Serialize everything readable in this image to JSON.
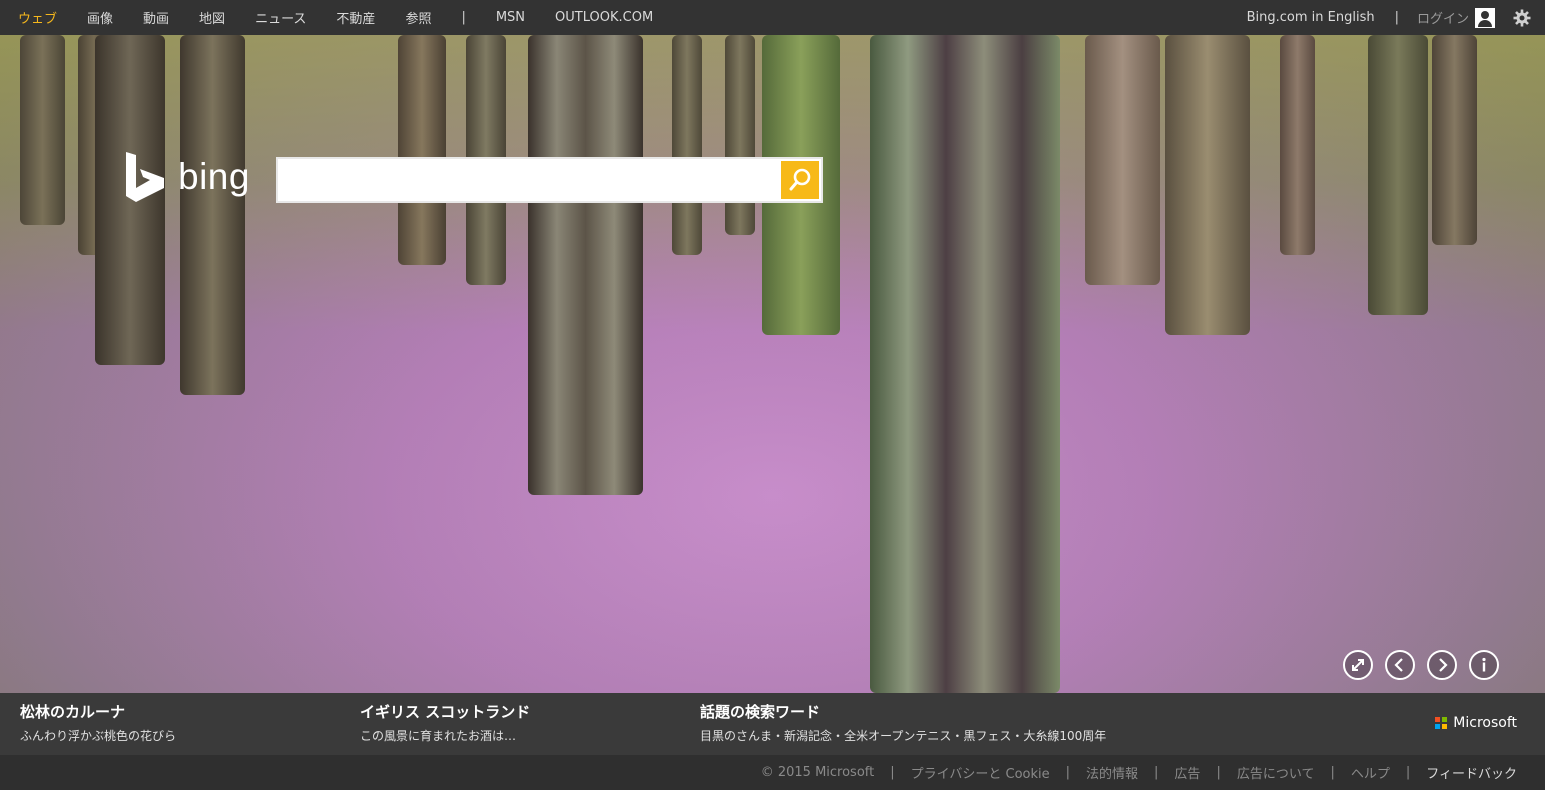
{
  "topnav": {
    "items": [
      "ウェブ",
      "画像",
      "動画",
      "地図",
      "ニュース",
      "不動産",
      "参照"
    ],
    "divider": "|",
    "extra": [
      "MSN",
      "OUTLOOK.COM"
    ],
    "lang_link": "Bing.com in English",
    "right_divider": "|",
    "login": "ログイン"
  },
  "logo": {
    "word": "bing"
  },
  "search": {
    "value": "",
    "placeholder": ""
  },
  "caption": {
    "block1": {
      "title": "松林のカルーナ",
      "sub": "ふんわり浮かぶ桃色の花びら"
    },
    "block2": {
      "title": "イギリス スコットランド",
      "sub": "この風景に育まれたお酒は…"
    },
    "block3": {
      "title": "話題の検索ワード",
      "items": [
        "目黒のさんま",
        "新潟記念",
        "全米オープンテニス",
        "黒フェス",
        "大糸線100周年"
      ],
      "separator": "・"
    },
    "brand": "Microsoft"
  },
  "footer": {
    "copyright": "© 2015 Microsoft",
    "links": [
      "プライバシーと Cookie",
      "法的情報",
      "広告",
      "広告について",
      "ヘルプ"
    ],
    "feedback": "フィードバック",
    "separator": "|"
  },
  "colors": {
    "accent": "#f5b71d",
    "search_button": "#f7b918",
    "topbar": "#333333"
  }
}
